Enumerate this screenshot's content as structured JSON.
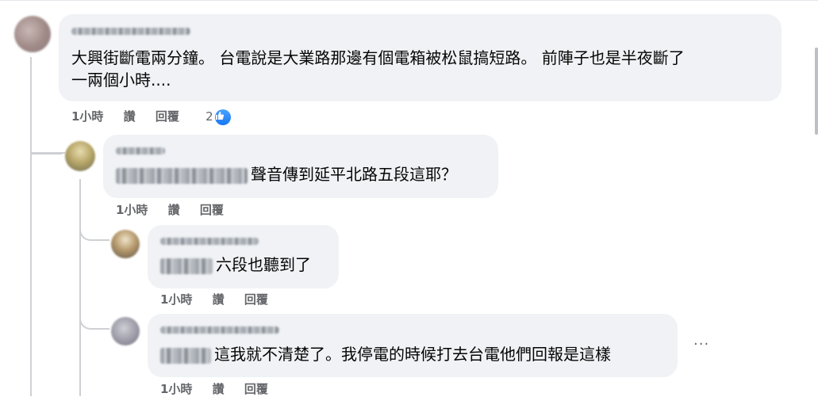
{
  "comments": [
    {
      "text_line1": "大興街斷電兩分鐘。 台電說是大業路那邊有個電箱被松鼠搞短路。 前陣子也是半夜斷了",
      "text_line2": "一兩個小時....",
      "time": "1小時",
      "like_label": "讚",
      "reply_label": "回覆",
      "reaction_count": "2"
    },
    {
      "text": "聲音傳到延平北路五段這耶？",
      "time": "1小時",
      "like_label": "讚",
      "reply_label": "回覆"
    },
    {
      "text": "六段也聽到了",
      "time": "1小時",
      "like_label": "讚",
      "reply_label": "回覆"
    },
    {
      "text": "這我就不清楚了。我停電的時候打去台電他們回報是這樣",
      "time": "1小時",
      "like_label": "讚",
      "reply_label": "回覆",
      "more_label": "···"
    }
  ],
  "colors": {
    "bubble": "#f0f2f5",
    "meta": "#65676b",
    "like_blue": "#1877f2",
    "thread_line": "#ced0d4"
  }
}
